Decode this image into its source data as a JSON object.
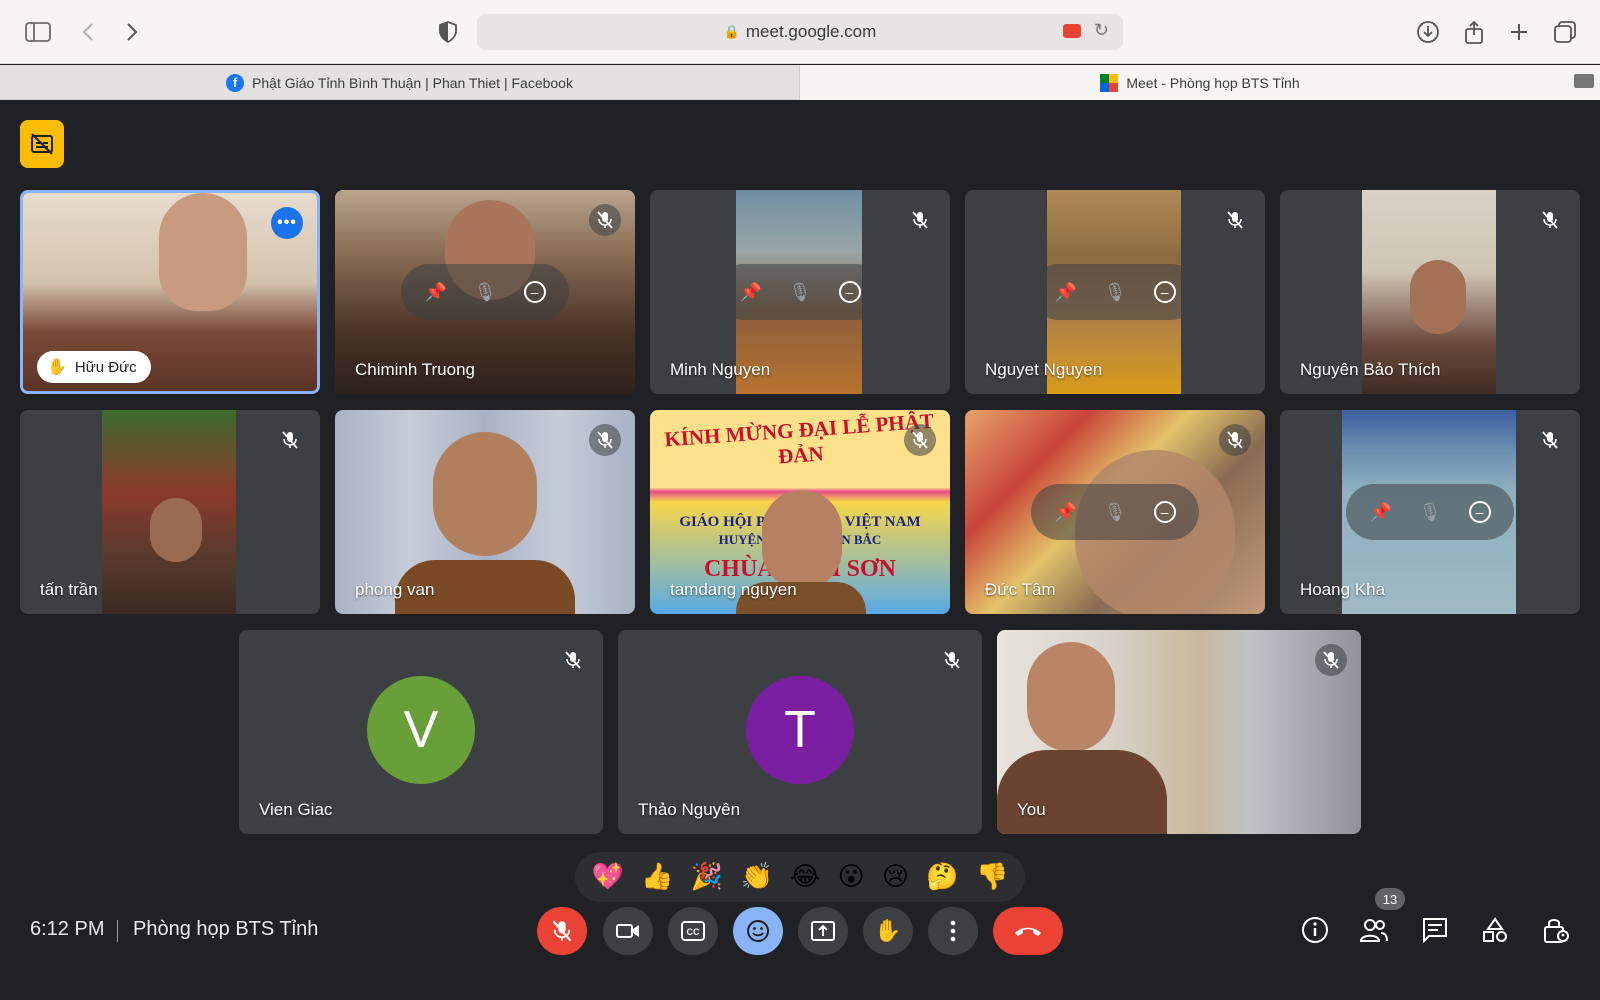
{
  "browser": {
    "url": "meet.google.com",
    "tabs": [
      {
        "label": "Phật Giáo Tỉnh Bình Thuận | Phan Thiet | Facebook"
      },
      {
        "label": "Meet - Phòng họp BTS Tỉnh"
      }
    ]
  },
  "participants": [
    {
      "name": "Hữu Đức",
      "hand_raised": true,
      "active": true
    },
    {
      "name": "Chiminh Truong"
    },
    {
      "name": "Minh Nguyen"
    },
    {
      "name": "Nguyet Nguyen"
    },
    {
      "name": "Nguyên Bảo Thích"
    },
    {
      "name": "tấn trần"
    },
    {
      "name": "phong van"
    },
    {
      "name": "tamdang nguyen",
      "banner_line1": "KÍNH MỪNG ĐẠI LỄ PHẬT ĐẢN",
      "banner_line2": "GIÁO HỘI PHẬT GIÁO VIỆT NAM",
      "banner_line3": "HUYỆN HÀM THUẬN BẮC",
      "banner_line4": "CHÙA LINH SƠN"
    },
    {
      "name": "Đức Tâm"
    },
    {
      "name": "Hoang Kha"
    },
    {
      "name": "Vien Giac",
      "initial": "V",
      "avatar_color": "#689f38"
    },
    {
      "name": "Thảo Nguyên",
      "initial": "T",
      "avatar_color": "#7b1fa2"
    },
    {
      "name": "You"
    }
  ],
  "reactions": [
    "💖",
    "👍",
    "🎉",
    "👏",
    "😂",
    "😮",
    "😢",
    "🤔",
    "👎"
  ],
  "footer": {
    "time": "6:12 PM",
    "meeting_name": "Phòng họp BTS Tỉnh",
    "participant_count": "13"
  },
  "colors": {
    "background": "#202124",
    "tile": "#3c4043",
    "accent_blue": "#8ab4f8",
    "danger_red": "#ea4335",
    "badge_yellow": "#fbbc04"
  }
}
